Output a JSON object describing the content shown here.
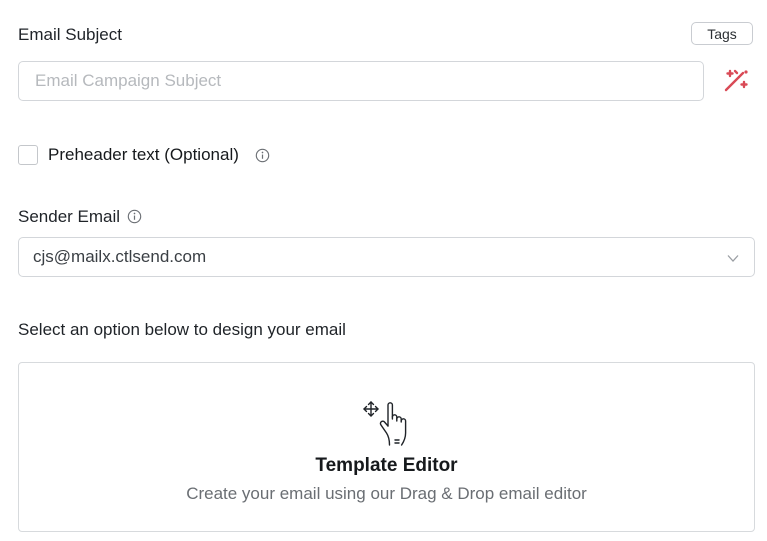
{
  "email_subject": {
    "label": "Email Subject",
    "tags_button": "Tags",
    "placeholder": "Email Campaign Subject",
    "value": ""
  },
  "preheader": {
    "label": "Preheader text (Optional)",
    "checked": false
  },
  "sender": {
    "label": "Sender Email",
    "selected": "cjs@mailx.ctlsend.com"
  },
  "design": {
    "prompt": "Select an option below to design your email",
    "card_title": "Template Editor",
    "card_description": "Create your email using our Drag & Drop email editor"
  },
  "colors": {
    "magic_icon": "#d94a56",
    "icon_stroke": "#1f2328"
  },
  "icons": {
    "info": "info-circle",
    "magic": "magic-wand",
    "chevron": "chevron-down",
    "editor": "drag-drop-hand"
  }
}
